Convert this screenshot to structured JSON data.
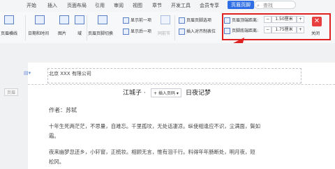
{
  "tabs": [
    "开始",
    "插入",
    "页面布局",
    "引用",
    "审阅",
    "视图",
    "章节",
    "开发工具",
    "会员专享",
    "页眉页脚"
  ],
  "search_placeholder": "查找",
  "ribbon": {
    "header_btn": "页眉横线",
    "datetime": "日期和时间",
    "picture": "图片",
    "field": "域",
    "switch": "页眉页脚切换",
    "show_prev": "显示前一项",
    "show_next": "显示后一项",
    "same_prev": "同前节",
    "options": "页眉页脚选项",
    "insert_align": "插入对齐制表位",
    "header_top_label": "页眉顶端距离:",
    "header_top_value": "1.50厘米",
    "footer_bottom_label": "页脚底端距离:",
    "footer_bottom_value": "1.75厘米",
    "close": "关闭"
  },
  "doc": {
    "header_tag": "页眉",
    "header_text": "北京 XXX 有限公司",
    "title_left": "江城子 ·",
    "insert_page": "插入页码",
    "title_right": "日夜记梦",
    "author": "作者：苏轼",
    "line1": "十年生死两茫茫，不思量，自难忘。千里孤坟，无处话凄凉。纵使相逢应不识，尘满面，鬓如",
    "line2": "霜。",
    "line3": "夜来幽梦忽还乡，小轩窗，正梳妆。相顾无言，惟有泪千行。料得年年肠断处，明月夜，短",
    "line4": "松冈。"
  }
}
